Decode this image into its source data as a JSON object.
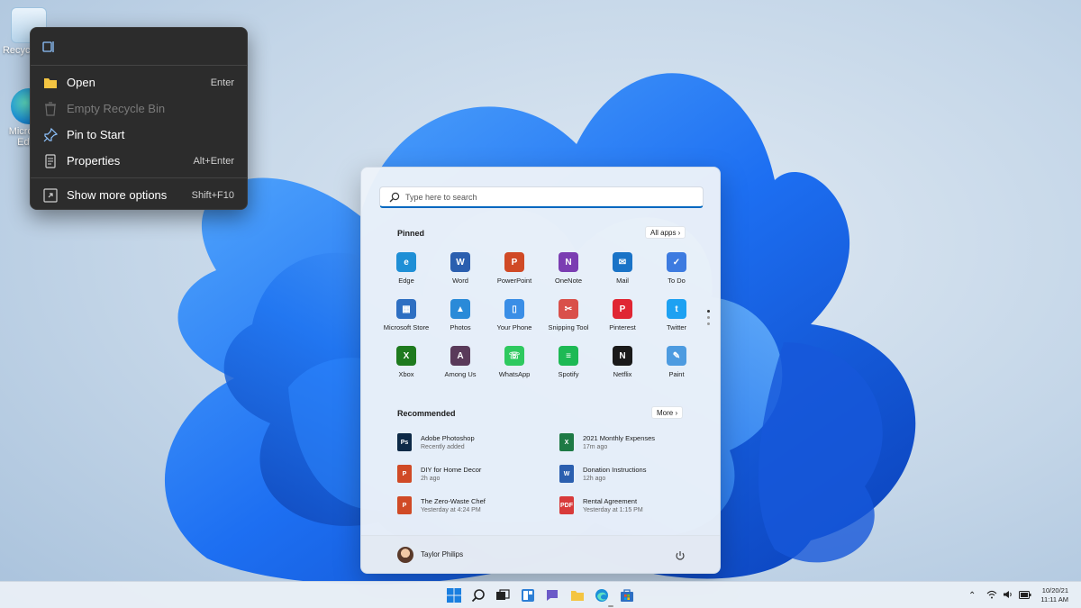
{
  "desktop": {
    "icons": [
      {
        "label": "Recycle Bin",
        "icon": "recycle-bin-icon"
      },
      {
        "label": "Microsoft Edge",
        "icon": "edge-icon"
      }
    ]
  },
  "context_menu": {
    "items": [
      {
        "label": "Open",
        "shortcut": "Enter",
        "icon": "folder-icon",
        "disabled": false
      },
      {
        "label": "Empty Recycle Bin",
        "shortcut": "",
        "icon": "trash-icon",
        "disabled": true
      },
      {
        "label": "Pin to Start",
        "shortcut": "",
        "icon": "pin-icon",
        "disabled": false
      },
      {
        "label": "Properties",
        "shortcut": "Alt+Enter",
        "icon": "properties-icon",
        "disabled": false
      },
      {
        "label": "Show more options",
        "shortcut": "Shift+F10",
        "icon": "more-options-icon",
        "disabled": false
      }
    ]
  },
  "start_menu": {
    "search_placeholder": "Type here to search",
    "pinned_title": "Pinned",
    "all_apps_label": "All apps ›",
    "pinned_apps": [
      {
        "label": "Edge",
        "color": "#1f8fd6",
        "glyph": "e"
      },
      {
        "label": "Word",
        "color": "#2b5faf",
        "glyph": "W"
      },
      {
        "label": "PowerPoint",
        "color": "#d04a26",
        "glyph": "P"
      },
      {
        "label": "OneNote",
        "color": "#7b3db2",
        "glyph": "N"
      },
      {
        "label": "Mail",
        "color": "#1a73c7",
        "glyph": "✉"
      },
      {
        "label": "To Do",
        "color": "#3d7be0",
        "glyph": "✓"
      },
      {
        "label": "Microsoft Store",
        "color": "#2e6fc2",
        "glyph": "▦"
      },
      {
        "label": "Photos",
        "color": "#2a8ad8",
        "glyph": "▲"
      },
      {
        "label": "Your Phone",
        "color": "#3a8ee6",
        "glyph": "▯"
      },
      {
        "label": "Snipping Tool",
        "color": "#d9504a",
        "glyph": "✂"
      },
      {
        "label": "Pinterest",
        "color": "#e02633",
        "glyph": "P"
      },
      {
        "label": "Twitter",
        "color": "#1da1f2",
        "glyph": "t"
      },
      {
        "label": "Xbox",
        "color": "#1e7a1e",
        "glyph": "X"
      },
      {
        "label": "Among Us",
        "color": "#5a3a5a",
        "glyph": "A"
      },
      {
        "label": "WhatsApp",
        "color": "#2ec95f",
        "glyph": "☏"
      },
      {
        "label": "Spotify",
        "color": "#1db954",
        "glyph": "≡"
      },
      {
        "label": "Netflix",
        "color": "#1a1a1a",
        "glyph": "N"
      },
      {
        "label": "Paint",
        "color": "#4d9be0",
        "glyph": "✎"
      }
    ],
    "recommended_title": "Recommended",
    "more_label": "More ›",
    "recommended": [
      {
        "title": "Adobe Photoshop",
        "subtitle": "Recently added",
        "color": "#0e2a47",
        "glyph": "Ps"
      },
      {
        "title": "2021 Monthly Expenses",
        "subtitle": "17m ago",
        "color": "#1e7a45",
        "glyph": "X"
      },
      {
        "title": "DIY for Home Decor",
        "subtitle": "2h ago",
        "color": "#d04a26",
        "glyph": "P"
      },
      {
        "title": "Donation Instructions",
        "subtitle": "12h ago",
        "color": "#2b5faf",
        "glyph": "W"
      },
      {
        "title": "The Zero-Waste Chef",
        "subtitle": "Yesterday at 4:24 PM",
        "color": "#d04a26",
        "glyph": "P"
      },
      {
        "title": "Rental Agreement",
        "subtitle": "Yesterday at 1:15 PM",
        "color": "#d83a3a",
        "glyph": "PDF"
      }
    ],
    "user_name": "Taylor Philips"
  },
  "taskbar": {
    "items": [
      "start-icon",
      "search-icon",
      "task-view-icon",
      "widgets-icon",
      "chat-icon",
      "file-explorer-icon",
      "edge-icon",
      "store-icon"
    ],
    "clock_date": "10/20/21",
    "clock_time": "11:11 AM"
  }
}
